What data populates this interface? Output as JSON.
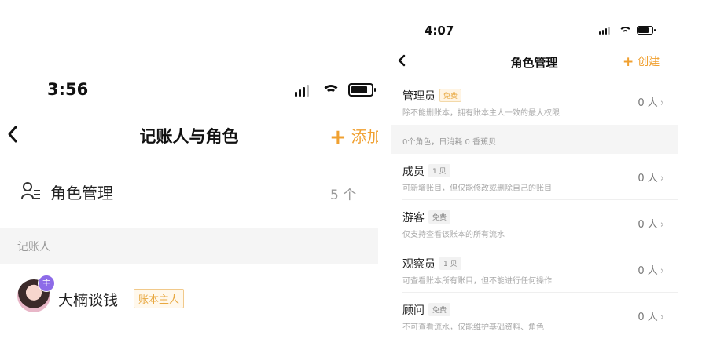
{
  "left_screen": {
    "status_bar": {
      "time": "3:56"
    },
    "nav": {
      "back_icon": "chevron-left-icon",
      "title": "记账人与角色",
      "add_label": "添加",
      "add_icon": "plus-icon"
    },
    "role_management": {
      "icon": "user-list-icon",
      "label": "角色管理",
      "count": "5 个"
    },
    "section_header": "记账人",
    "members": [
      {
        "name": "大楠谈钱",
        "tag": "账本主人",
        "badge": "主"
      }
    ]
  },
  "right_screen": {
    "status_bar": {
      "time": "4:07"
    },
    "nav": {
      "back_icon": "chevron-left-icon",
      "title": "角色管理",
      "create_label": "创建",
      "create_icon": "plus-icon"
    },
    "roles_top": [
      {
        "name": "管理员",
        "chip": "免费",
        "chip_type": "free",
        "desc": "除不能删账本，拥有账本主人一致的最大权限",
        "count": "0 人"
      }
    ],
    "summary": "0个角色，日消耗 0 香蕉贝",
    "roles": [
      {
        "name": "成员",
        "chip": "1 贝",
        "chip_type": "paid",
        "desc": "可新增账目，但仅能修改或删除自己的账目",
        "count": "0 人"
      },
      {
        "name": "游客",
        "chip": "免费",
        "chip_type": "paid",
        "desc": "仅支持查看该账本的所有流水",
        "count": "0 人"
      },
      {
        "name": "观察员",
        "chip": "1 贝",
        "chip_type": "paid",
        "desc": "可查看账本所有账目，但不能进行任何操作",
        "count": "0 人"
      },
      {
        "name": "顾问",
        "chip": "免费",
        "chip_type": "paid",
        "desc": "不可查看流水，仅能维护基础资料、角色",
        "count": "0 人"
      }
    ]
  }
}
